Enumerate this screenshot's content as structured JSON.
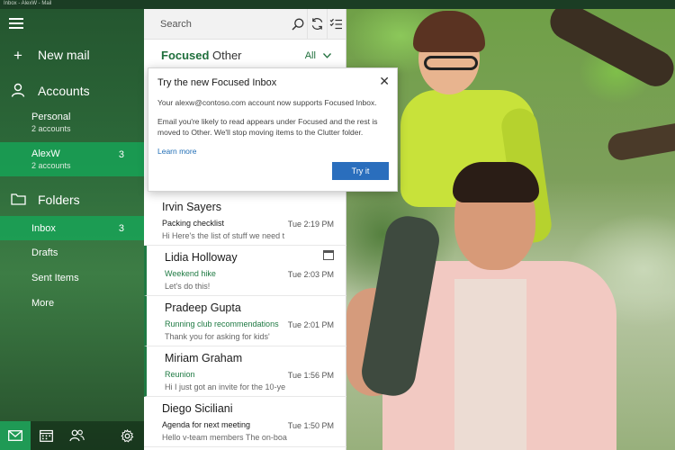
{
  "titlebar": {
    "text": "Inbox - AlexW - Mail"
  },
  "nav": {
    "new_mail": "New mail",
    "accounts": "Accounts",
    "accounts_list": [
      {
        "name": "Personal",
        "sub": "2 accounts"
      },
      {
        "name": "AlexW",
        "sub": "2 accounts",
        "count": "3"
      }
    ],
    "folders": "Folders",
    "folder_items": [
      {
        "name": "Inbox",
        "count": "3"
      },
      {
        "name": "Drafts"
      },
      {
        "name": "Sent Items"
      },
      {
        "name": "More"
      }
    ],
    "bottom_icons": [
      "mail-icon",
      "calendar-icon",
      "people-icon",
      "gear-icon"
    ]
  },
  "search": {
    "placeholder": "Search"
  },
  "tabs": {
    "focused": "Focused",
    "other": "Other",
    "filter": "All"
  },
  "popup": {
    "title": "Try the new Focused Inbox",
    "line1": "Your alexw@contoso.com account now supports Focused Inbox.",
    "line2": "Email you're likely to read appears under Focused and the rest is moved to Other. We'll stop moving items to the Clutter folder.",
    "link": "Learn more",
    "button": "Try it"
  },
  "mails": [
    {
      "from": "Irvin Sayers",
      "subject": "Packing checklist",
      "preview": "Hi Here's the list of stuff we need t",
      "time": "Tue 2:19 PM",
      "unread": false
    },
    {
      "from": "Lidia Holloway",
      "subject": "Weekend hike",
      "preview": "Let's do this!",
      "time": "Tue 2:03 PM",
      "unread": true,
      "has_calendar": true
    },
    {
      "from": "Pradeep Gupta",
      "subject": "Running club recommendations",
      "preview": "Thank you for asking for kids'",
      "time": "Tue 2:01 PM",
      "unread": true
    },
    {
      "from": "Miriam Graham",
      "subject": "Reunion",
      "preview": "Hi I just got an invite for the 10-ye",
      "time": "Tue 1:56 PM",
      "unread": true
    },
    {
      "from": "Diego Siciliani",
      "subject": "Agenda for next meeting",
      "preview": "Hello v-team members The on-boa",
      "time": "Tue 1:50 PM",
      "unread": false
    }
  ]
}
